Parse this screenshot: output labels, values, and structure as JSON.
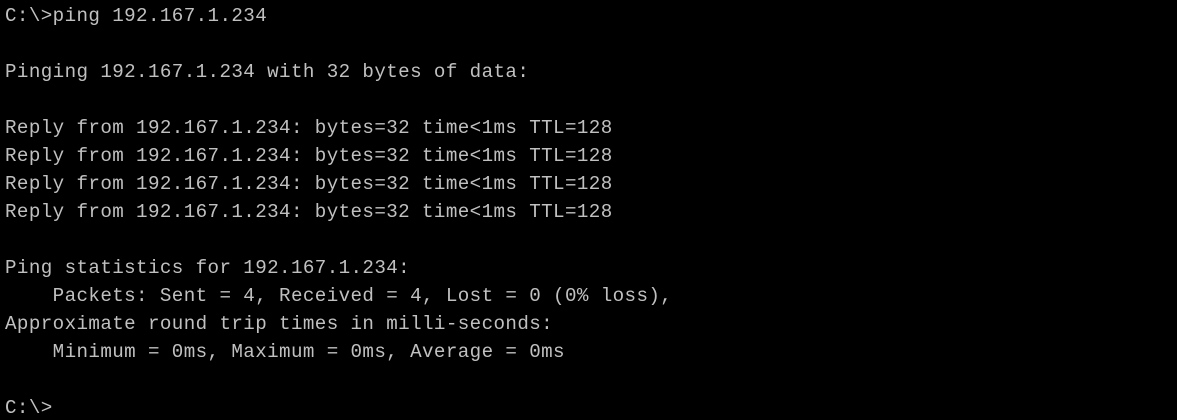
{
  "terminal": {
    "background_color": "#000000",
    "text_color": "#c0c0c0",
    "lines": [
      "C:\\>ping 192.167.1.234",
      "Pinging 192.167.1.234 with 32 bytes of data:",
      "Reply from 192.167.1.234: bytes=32 time<1ms TTL=128",
      "Reply from 192.167.1.234: bytes=32 time<1ms TTL=128",
      "Reply from 192.167.1.234: bytes=32 time<1ms TTL=128",
      "Reply from 192.167.1.234: bytes=32 time<1ms TTL=128",
      "Ping statistics for 192.167.1.234:",
      "    Packets: Sent = 4, Received = 4, Lost = 0 (0% loss),",
      "Approximate round trip times in milli-seconds:",
      "    Minimum = 0ms, Maximum = 0ms, Average = 0ms",
      "C:\\>"
    ]
  }
}
